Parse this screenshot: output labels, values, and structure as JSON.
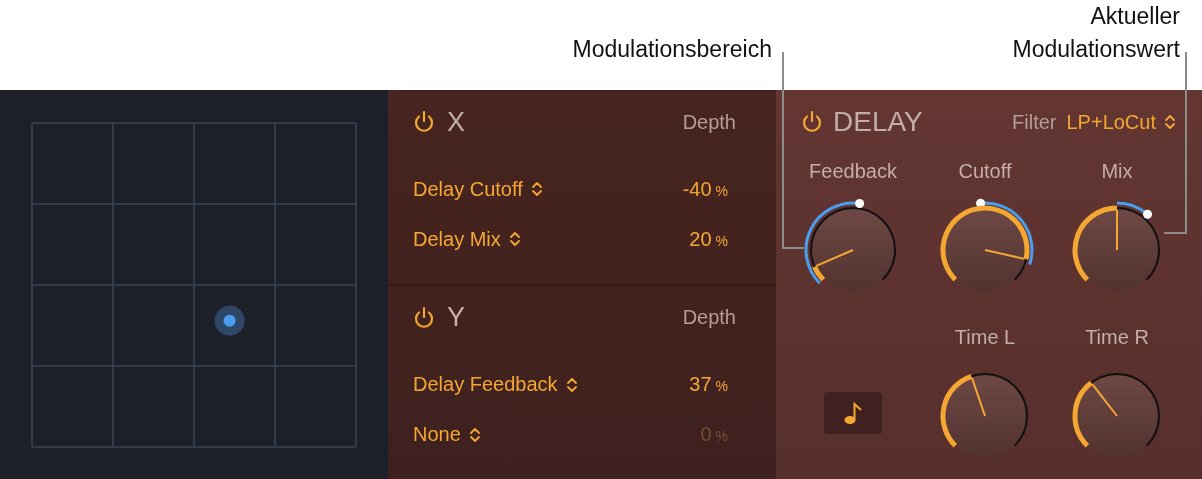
{
  "callouts": [
    {
      "text": "Modulationsbereich"
    },
    {
      "text": "Aktueller\nModulationswert"
    }
  ],
  "modulation": [
    {
      "title": "X",
      "on": true,
      "depth_label": "Depth",
      "rows": [
        {
          "target": "Delay Cutoff",
          "value": "-40",
          "unit": "%",
          "disabled": false
        },
        {
          "target": "Delay Mix",
          "value": "20",
          "unit": "%",
          "disabled": false
        }
      ]
    },
    {
      "title": "Y",
      "on": true,
      "depth_label": "Depth",
      "rows": [
        {
          "target": "Delay Feedback",
          "value": "37",
          "unit": "%",
          "disabled": false
        },
        {
          "target": "None",
          "value": "0",
          "unit": "%",
          "disabled": true
        }
      ]
    }
  ],
  "delay": {
    "title": "DELAY",
    "on": true,
    "filter_label": "Filter",
    "filter_value": "LP+LoCut",
    "knobs": [
      {
        "label": "Feedback"
      },
      {
        "label": "Cutoff"
      },
      {
        "label": "Mix"
      },
      {
        "label": "Time L"
      },
      {
        "label": "Time R"
      }
    ],
    "sync": {
      "on": true
    }
  }
}
